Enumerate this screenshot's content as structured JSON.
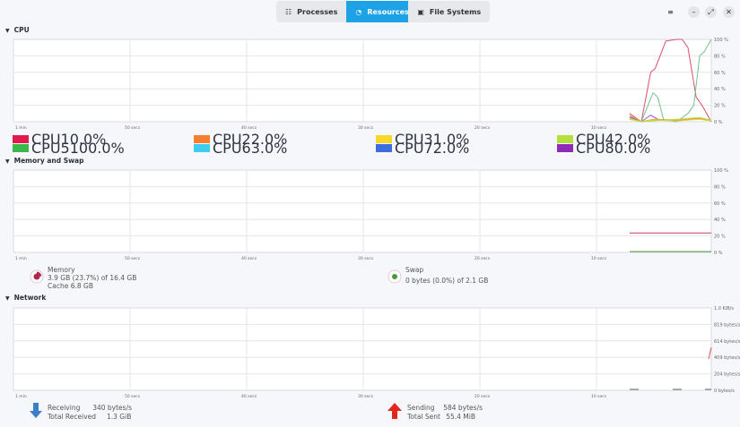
{
  "tabs": [
    {
      "label": "Processes",
      "icon": "list-icon"
    },
    {
      "label": "Resources",
      "icon": "gauge-icon",
      "active": true
    },
    {
      "label": "File Systems",
      "icon": "disk-icon"
    }
  ],
  "window": {
    "menu": "≡",
    "minimize": "–",
    "maximize": "⤢",
    "close": "✕"
  },
  "time_labels": [
    "1 min",
    "50 secs",
    "40 secs",
    "30 secs",
    "20 secs",
    "10 secs"
  ],
  "cpu": {
    "title": "CPU",
    "axis": [
      "100 %",
      "80 %",
      "60 %",
      "40 %",
      "20 %",
      "0 %"
    ],
    "legend": [
      {
        "name": "CPU1",
        "value": "0.0%",
        "color": "#e01b4b"
      },
      {
        "name": "CPU2",
        "value": "2.0%",
        "color": "#f57f2e"
      },
      {
        "name": "CPU3",
        "value": "1.0%",
        "color": "#f8d92a"
      },
      {
        "name": "CPU4",
        "value": "2.0%",
        "color": "#b4e03c"
      },
      {
        "name": "CPU5",
        "value": "100.0%",
        "color": "#3cb74a"
      },
      {
        "name": "CPU6",
        "value": "3.0%",
        "color": "#3ccdf0"
      },
      {
        "name": "CPU7",
        "value": "2.0%",
        "color": "#3c6ee0"
      },
      {
        "name": "CPU8",
        "value": "0.0%",
        "color": "#8e2cb8"
      }
    ],
    "series": [
      {
        "color": "#d94e6f",
        "points": [
          [
            7.0,
            10
          ],
          [
            6.0,
            0
          ],
          [
            5.2,
            60
          ],
          [
            4.8,
            65
          ],
          [
            3.9,
            98
          ],
          [
            3.0,
            100
          ],
          [
            2.5,
            100
          ],
          [
            2.0,
            90
          ],
          [
            1.3,
            30
          ],
          [
            0.8,
            20
          ],
          [
            0,
            0
          ]
        ]
      },
      {
        "color": "#6fc48a",
        "points": [
          [
            7.0,
            5
          ],
          [
            6.0,
            0
          ],
          [
            5.0,
            35
          ],
          [
            4.6,
            30
          ],
          [
            4.1,
            3
          ],
          [
            3.0,
            0
          ],
          [
            2.0,
            10
          ],
          [
            1.5,
            20
          ],
          [
            1.0,
            80
          ],
          [
            0.6,
            85
          ],
          [
            0,
            100
          ]
        ]
      },
      {
        "color": "#a050d0",
        "points": [
          [
            7.0,
            6
          ],
          [
            6.0,
            0
          ],
          [
            5.2,
            8
          ],
          [
            4.6,
            3
          ],
          [
            3.0,
            1
          ],
          [
            1.5,
            4
          ],
          [
            0,
            2
          ]
        ]
      },
      {
        "color": "#f0a040",
        "points": [
          [
            7.0,
            8
          ],
          [
            6.0,
            0
          ],
          [
            5.0,
            3
          ],
          [
            3.0,
            2
          ],
          [
            1.0,
            4
          ],
          [
            0,
            2
          ]
        ]
      },
      {
        "color": "#e0d040",
        "points": [
          [
            7.0,
            4
          ],
          [
            6.0,
            0
          ],
          [
            5.0,
            2
          ],
          [
            3.0,
            1
          ],
          [
            1.0,
            3
          ],
          [
            0,
            1
          ]
        ]
      },
      {
        "color": "#b0e040",
        "points": [
          [
            7.0,
            3
          ],
          [
            6.0,
            0
          ],
          [
            4.0,
            2
          ],
          [
            1.0,
            5
          ],
          [
            0,
            2
          ]
        ]
      }
    ]
  },
  "memory": {
    "title": "Memory and Swap",
    "axis": [
      "100 %",
      "80 %",
      "60 %",
      "40 %",
      "20 %",
      "0 %"
    ],
    "mem_label": "Memory",
    "mem_value": "3.9 GB (23.7%) of 16.4 GB",
    "mem_cache": "Cache 6.8 GB",
    "mem_percent": 23.7,
    "mem_color": "#b0264f",
    "swap_label": "Swap",
    "swap_value": "0 bytes (0.0%) of 2.1 GB",
    "swap_percent": 0,
    "swap_color": "#4a9a3a"
  },
  "network": {
    "title": "Network",
    "axis": [
      "1.0 KiB/s",
      "819 bytes/s",
      "614 bytes/s",
      "409 bytes/s",
      "204 bytes/s",
      "0 bytes/s"
    ],
    "receiving_label": "Receiving",
    "receiving_value": "340 bytes/s",
    "total_received_label": "Total Received",
    "total_received_value": "1.3 GiB",
    "sending_label": "Sending",
    "sending_value": "584 bytes/s",
    "total_sent_label": "Total Sent",
    "total_sent_value": "55.4 MiB"
  }
}
